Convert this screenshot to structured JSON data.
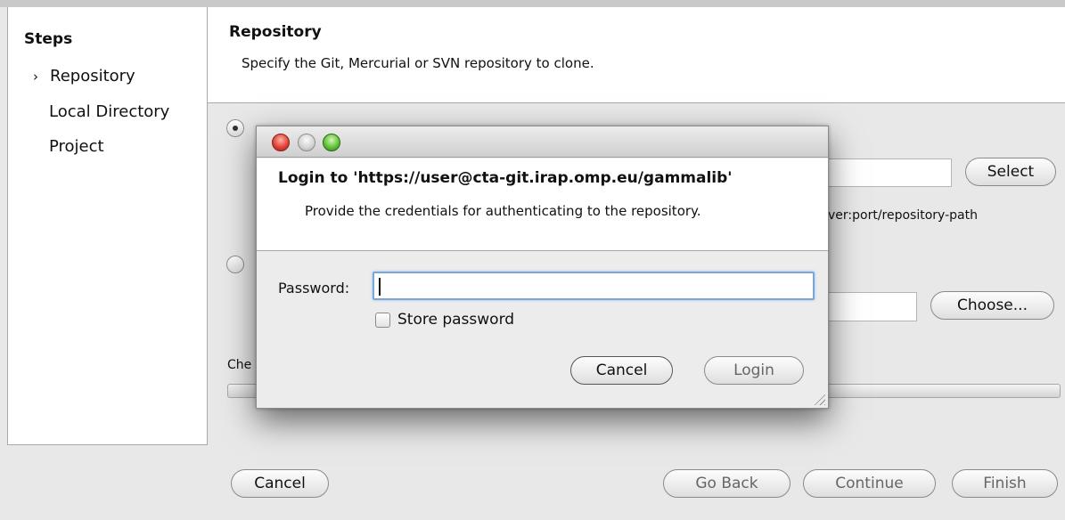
{
  "sidebar": {
    "title": "Steps",
    "current_marker": "›",
    "items": [
      {
        "label": "Repository"
      },
      {
        "label": "Local Directory"
      },
      {
        "label": "Project"
      }
    ]
  },
  "header": {
    "title": "Repository",
    "subtitle": "Specify the Git, Mercurial or SVN repository to clone."
  },
  "content": {
    "select_button": "Select",
    "url_hint": "ver:port/repository-path",
    "choose_button": "Choose...",
    "checkout_label_partial": "Che"
  },
  "footer": {
    "cancel": "Cancel",
    "go_back": "Go Back",
    "continue": "Continue",
    "finish": "Finish"
  },
  "dialog": {
    "title": "Login to 'https://user@cta-git.irap.omp.eu/gammalib'",
    "subtitle": "Provide the credentials for authenticating to the repository.",
    "password_label": "Password:",
    "password_value": "",
    "store_password_label": "Store password",
    "store_password_checked": false,
    "cancel_button": "Cancel",
    "login_button": "Login"
  }
}
